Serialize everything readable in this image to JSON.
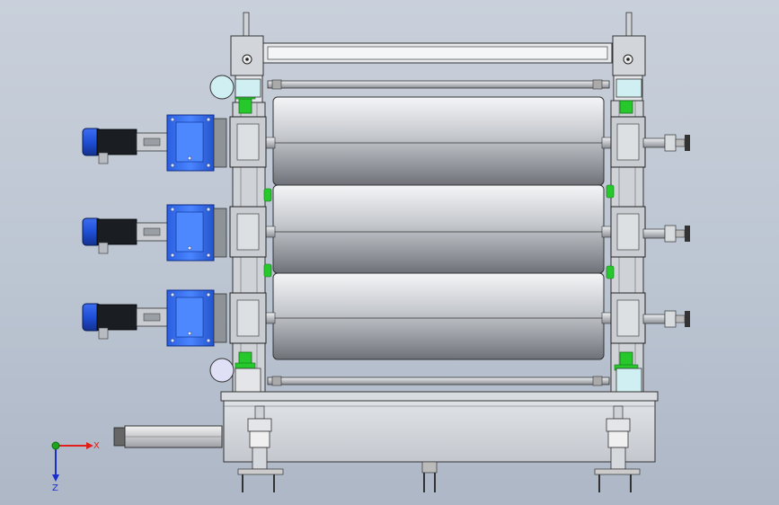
{
  "view": {
    "background_top": "#c9d0db",
    "background_bottom": "#adb7c6"
  },
  "colors": {
    "motor_blue": "#1f4fd6",
    "gearbox_blue": "#2f6cf0",
    "roller_light": "#f4f5f7",
    "roller_dark": "#7f8288",
    "frame_gray": "#d2d5da",
    "bearing_green": "#27c82b",
    "disk_cyan": "#cfeff2",
    "axis_x_red": "#e0201a",
    "axis_y_green": "#1aa51a",
    "axis_z_blue": "#1a2ed0"
  },
  "rollers": [
    {
      "name": "top-roller"
    },
    {
      "name": "middle-roller"
    },
    {
      "name": "bottom-roller"
    }
  ],
  "drives": [
    {
      "name": "top-drive"
    },
    {
      "name": "middle-drive"
    },
    {
      "name": "bottom-drive"
    }
  ],
  "triad": {
    "x_label": "X",
    "z_label": "Z"
  }
}
